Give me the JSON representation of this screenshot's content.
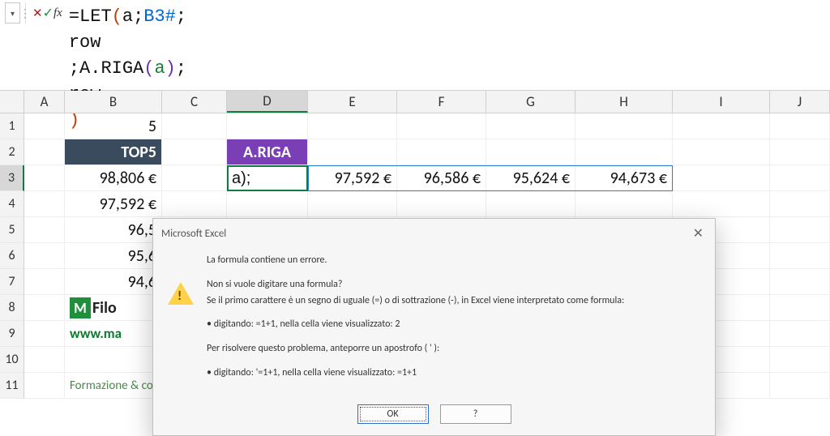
{
  "formula_bar": {
    "name_box": "",
    "formula_lines": [
      "=LET(a;B3#;",
      "row;A.RIGA(a);",
      "row)"
    ]
  },
  "columns": [
    "",
    "A",
    "B",
    "C",
    "D",
    "E",
    "F",
    "G",
    "H",
    "I",
    "J"
  ],
  "active_col": "D",
  "active_row": "3",
  "rows": [
    "1",
    "2",
    "3",
    "4",
    "5",
    "6",
    "7",
    "8",
    "9",
    "10",
    "11"
  ],
  "cells": {
    "B1": "5",
    "B2": "TOP5",
    "D2": "A.RIGA",
    "B3": "98,806 €",
    "B4": "97,592 €",
    "B5": "96,5",
    "B6": "95,6",
    "B7": "94,6",
    "D3_edit": "a);",
    "E3": "97,592 €",
    "F3": "96,586 €",
    "G3": "95,624 €",
    "H3": "94,673 €"
  },
  "brand": {
    "logo_text": "Filo",
    "url": "www.ma",
    "sub": "Formazione & consulenza Microsoft Excel"
  },
  "dialog": {
    "title": "Microsoft Excel",
    "p1": "La formula contiene un errore.",
    "p2": "Non si vuole digitare una formula?",
    "p3": "Se il primo carattere è un segno di uguale (=) o di sottrazione (-), in Excel viene interpretato come formula:",
    "p4": "• digitando: =1+1, nella cella viene visualizzato: 2",
    "p5": "Per risolvere questo problema, anteporre un apostrofo ( ' ):",
    "p6": "• digitando: '=1+1, nella cella viene visualizzato: =1+1",
    "ok": "OK",
    "help": "?"
  }
}
